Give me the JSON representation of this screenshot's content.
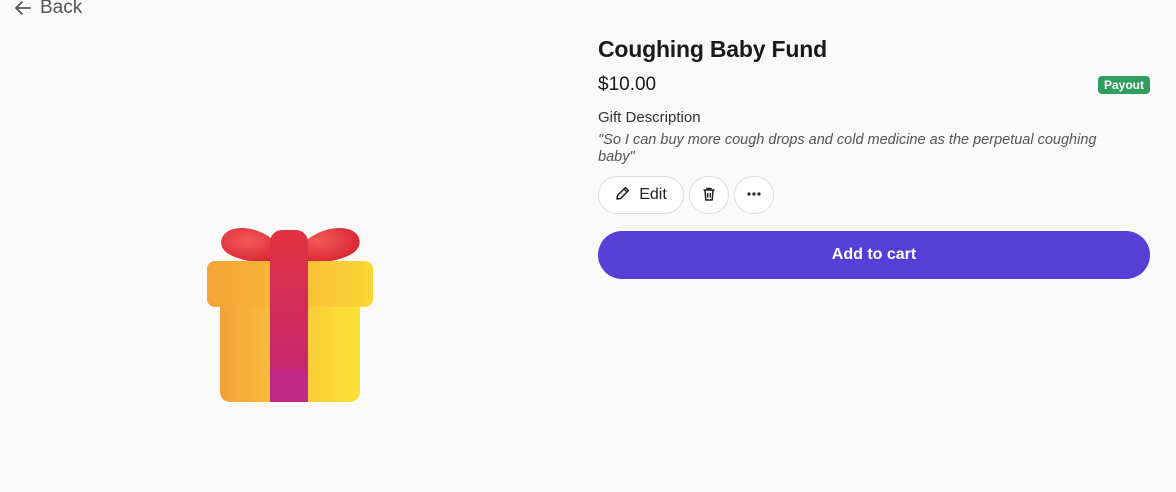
{
  "nav": {
    "back_label": "Back",
    "back_icon": "arrow-left-icon"
  },
  "product": {
    "title": "Coughing Baby Fund",
    "price": "$10.00",
    "badge": "Payout",
    "description_label": "Gift Description",
    "description": "\"So I can buy more cough drops and cold medicine as the perpetual coughing baby\"",
    "image_icon": "gift-icon"
  },
  "actions": {
    "edit_label": "Edit",
    "edit_icon": "pencil-icon",
    "delete_icon": "trash-icon",
    "more_icon": "more-horizontal-icon",
    "add_to_cart_label": "Add to cart"
  },
  "colors": {
    "accent": "#553fd6",
    "badge": "#2f9e5f",
    "background": "#fafafa"
  }
}
